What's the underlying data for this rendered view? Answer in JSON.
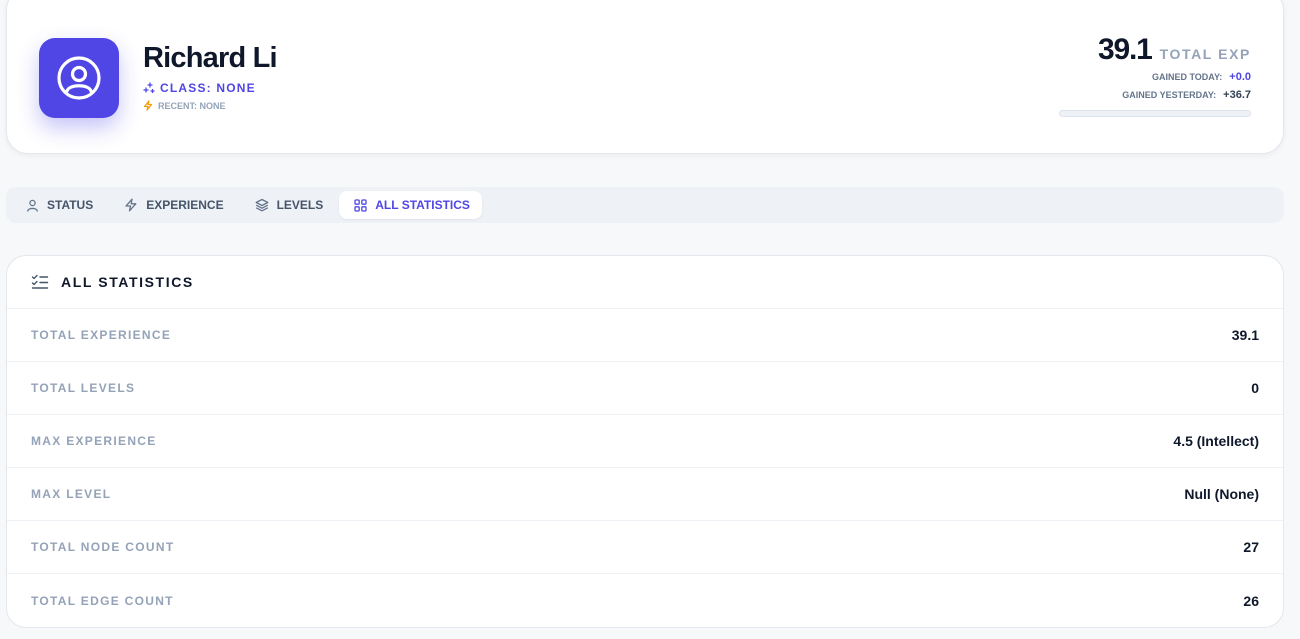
{
  "profile": {
    "name": "Richard Li",
    "class_label": "CLASS: NONE",
    "recent_label": "RECENT: NONE",
    "accent_color": "#4f46e5"
  },
  "experience": {
    "total_value": "39.1",
    "total_label": "TOTAL EXP",
    "gained_today_label": "GAINED TODAY:",
    "gained_today_value": "+0.0",
    "gained_yesterday_label": "GAINED YESTERDAY:",
    "gained_yesterday_value": "+36.7",
    "progress_fraction": 0.0
  },
  "tabs": [
    {
      "label": "STATUS",
      "icon": "user-icon",
      "active": false
    },
    {
      "label": "EXPERIENCE",
      "icon": "lightning-icon",
      "active": false
    },
    {
      "label": "LEVELS",
      "icon": "layers-icon",
      "active": false
    },
    {
      "label": "ALL STATISTICS",
      "icon": "grid-icon",
      "active": true
    }
  ],
  "statistics": {
    "title": "ALL STATISTICS",
    "icon": "list-check-icon",
    "rows": [
      {
        "label": "TOTAL EXPERIENCE",
        "value": "39.1"
      },
      {
        "label": "TOTAL LEVELS",
        "value": "0"
      },
      {
        "label": "MAX EXPERIENCE",
        "value": "4.5 (Intellect)"
      },
      {
        "label": "MAX LEVEL",
        "value": "Null (None)"
      },
      {
        "label": "TOTAL NODE COUNT",
        "value": "27"
      },
      {
        "label": "TOTAL EDGE COUNT",
        "value": "26"
      }
    ]
  }
}
